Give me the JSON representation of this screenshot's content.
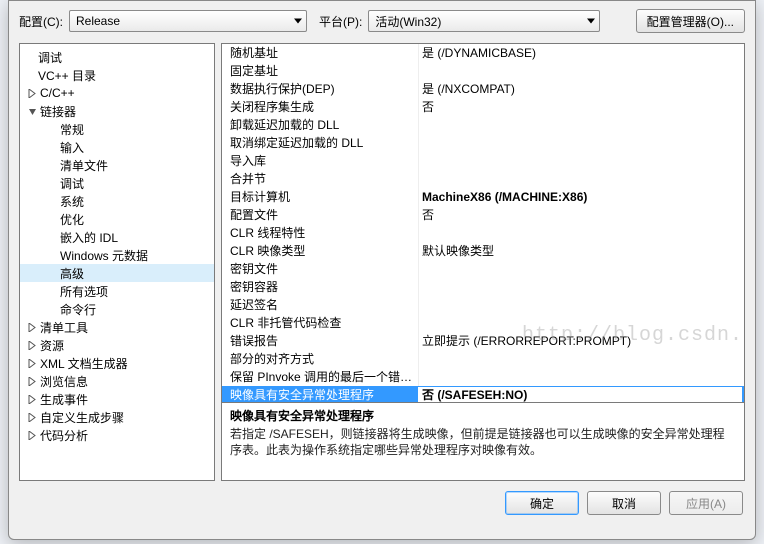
{
  "topbar": {
    "config_label": "配置(C):",
    "config_value": "Release",
    "platform_label": "平台(P):",
    "platform_value": "活动(Win32)",
    "manager_button": "配置管理器(O)..."
  },
  "tree": [
    {
      "label": "调试",
      "depth": 1,
      "twisty": "none"
    },
    {
      "label": "VC++ 目录",
      "depth": 1,
      "twisty": "none"
    },
    {
      "label": "C/C++",
      "depth": 1,
      "twisty": "closed"
    },
    {
      "label": "链接器",
      "depth": 1,
      "twisty": "open"
    },
    {
      "label": "常规",
      "depth": 2,
      "twisty": "none"
    },
    {
      "label": "输入",
      "depth": 2,
      "twisty": "none"
    },
    {
      "label": "清单文件",
      "depth": 2,
      "twisty": "none"
    },
    {
      "label": "调试",
      "depth": 2,
      "twisty": "none"
    },
    {
      "label": "系统",
      "depth": 2,
      "twisty": "none"
    },
    {
      "label": "优化",
      "depth": 2,
      "twisty": "none"
    },
    {
      "label": "嵌入的 IDL",
      "depth": 2,
      "twisty": "none"
    },
    {
      "label": "Windows 元数据",
      "depth": 2,
      "twisty": "none"
    },
    {
      "label": "高级",
      "depth": 2,
      "twisty": "none",
      "selected": true
    },
    {
      "label": "所有选项",
      "depth": 2,
      "twisty": "none"
    },
    {
      "label": "命令行",
      "depth": 2,
      "twisty": "none"
    },
    {
      "label": "清单工具",
      "depth": 1,
      "twisty": "closed"
    },
    {
      "label": "资源",
      "depth": 1,
      "twisty": "closed"
    },
    {
      "label": "XML 文档生成器",
      "depth": 1,
      "twisty": "closed"
    },
    {
      "label": "浏览信息",
      "depth": 1,
      "twisty": "closed"
    },
    {
      "label": "生成事件",
      "depth": 1,
      "twisty": "closed"
    },
    {
      "label": "自定义生成步骤",
      "depth": 1,
      "twisty": "closed"
    },
    {
      "label": "代码分析",
      "depth": 1,
      "twisty": "closed"
    }
  ],
  "grid": [
    {
      "name": "随机基址",
      "value": "是 (/DYNAMICBASE)"
    },
    {
      "name": "固定基址",
      "value": ""
    },
    {
      "name": "数据执行保护(DEP)",
      "value": "是 (/NXCOMPAT)"
    },
    {
      "name": "关闭程序集生成",
      "value": "否"
    },
    {
      "name": "卸载延迟加载的 DLL",
      "value": ""
    },
    {
      "name": "取消绑定延迟加载的 DLL",
      "value": ""
    },
    {
      "name": "导入库",
      "value": ""
    },
    {
      "name": "合并节",
      "value": ""
    },
    {
      "name": "目标计算机",
      "value": "MachineX86 (/MACHINE:X86)",
      "bold": true
    },
    {
      "name": "配置文件",
      "value": "否"
    },
    {
      "name": "CLR 线程特性",
      "value": ""
    },
    {
      "name": "CLR 映像类型",
      "value": "默认映像类型"
    },
    {
      "name": "密钥文件",
      "value": ""
    },
    {
      "name": "密钥容器",
      "value": ""
    },
    {
      "name": "延迟签名",
      "value": ""
    },
    {
      "name": "CLR 非托管代码检查",
      "value": ""
    },
    {
      "name": "错误报告",
      "value": "立即提示 (/ERRORREPORT:PROMPT)"
    },
    {
      "name": "部分的对齐方式",
      "value": ""
    },
    {
      "name": "保留 PInvoke 调用的最后一个错误代",
      "value": ""
    },
    {
      "name": "映像具有安全异常处理程序",
      "value": "否 (/SAFESEH:NO)",
      "selected": true
    }
  ],
  "desc": {
    "title": "映像具有安全异常处理程序",
    "text": "若指定 /SAFESEH，则链接器将生成映像，但前提是链接器也可以生成映像的安全异常处理程序表。此表为操作系统指定哪些异常处理程序对映像有效。"
  },
  "footer": {
    "ok": "确定",
    "cancel": "取消",
    "apply": "应用(A)"
  },
  "watermark": "http://blog.csdn.net/"
}
